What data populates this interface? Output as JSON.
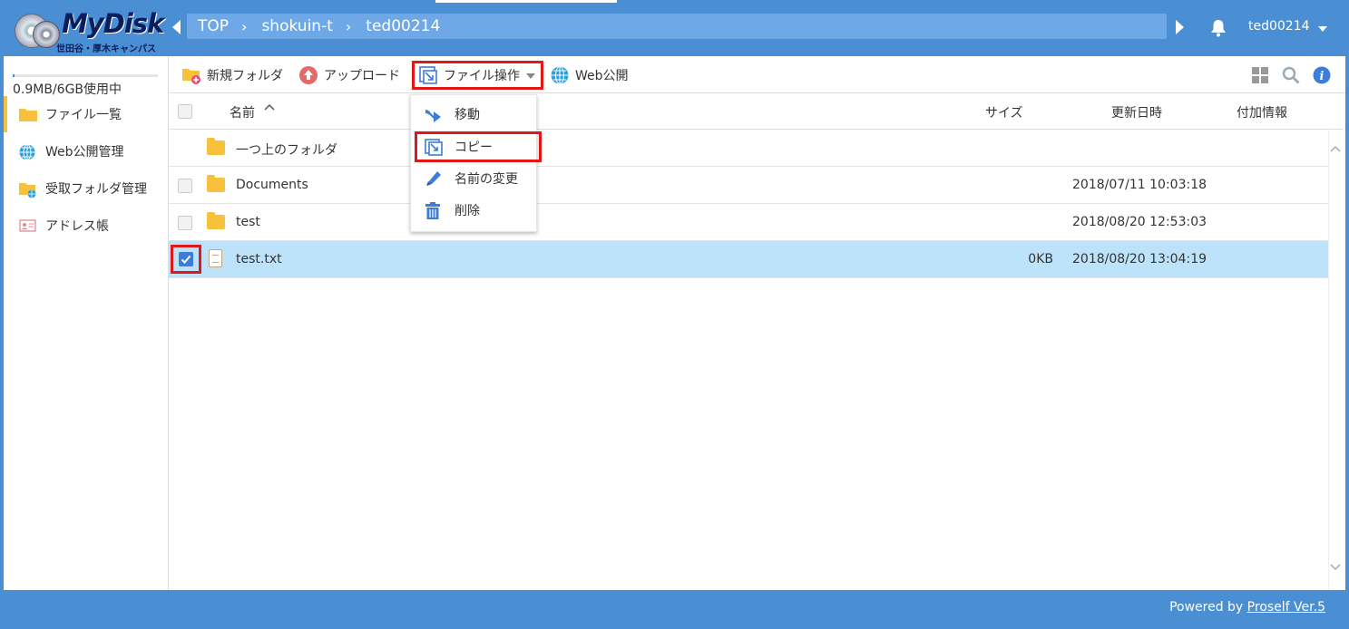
{
  "app": {
    "logo_title": "MyDisk",
    "logo_subtitle": "世田谷・厚木キャンパス"
  },
  "breadcrumb": {
    "items": [
      "TOP",
      "shokuin-t",
      "ted00214"
    ],
    "separator": "›"
  },
  "user": {
    "name": "ted00214"
  },
  "sidebar": {
    "usage_text": "0.9MB/6GB使用中",
    "usage_fraction": 0.0015,
    "items": [
      {
        "label": "ファイル一覧",
        "icon": "folder-icon",
        "active": true
      },
      {
        "label": "Web公開管理",
        "icon": "globe-icon",
        "active": false
      },
      {
        "label": "受取フォルダ管理",
        "icon": "receive-folder-icon",
        "active": false
      },
      {
        "label": "アドレス帳",
        "icon": "address-book-icon",
        "active": false
      }
    ]
  },
  "toolbar": {
    "new_folder": "新規フォルダ",
    "upload": "アップロード",
    "file_ops": "ファイル操作",
    "web_publish": "Web公開"
  },
  "table": {
    "headers": {
      "name": "名前",
      "name_sort": "^",
      "size": "サイズ",
      "modified": "更新日時",
      "extra": "付加情報"
    },
    "rows": [
      {
        "name": "一つ上のフォルダ",
        "type": "folder",
        "size": "",
        "modified": "",
        "checkbox": false,
        "selected": false
      },
      {
        "name": "Documents",
        "type": "folder",
        "size": "",
        "modified": "2018/07/11 10:03:18",
        "checkbox": true,
        "selected": false
      },
      {
        "name": "test",
        "type": "folder",
        "size": "",
        "modified": "2018/08/20 12:53:03",
        "checkbox": true,
        "selected": false
      },
      {
        "name": "test.txt",
        "type": "file",
        "size": "0KB",
        "modified": "2018/08/20 13:04:19",
        "checkbox": true,
        "selected": true
      }
    ]
  },
  "dropdown": {
    "items": [
      {
        "label": "移動",
        "icon": "move-icon"
      },
      {
        "label": "コピー",
        "icon": "copy-icon"
      },
      {
        "label": "名前の変更",
        "icon": "rename-icon"
      },
      {
        "label": "削除",
        "icon": "trash-icon"
      }
    ]
  },
  "footer": {
    "powered_prefix": "Powered by ",
    "powered_link": "Proself Ver.5"
  },
  "colors": {
    "header": "#4a8fd4",
    "breadcrumb_bg": "#6fa8e6",
    "selected_row": "#bde3fb",
    "highlight_box": "#e01818",
    "folder": "#f8c13b"
  }
}
